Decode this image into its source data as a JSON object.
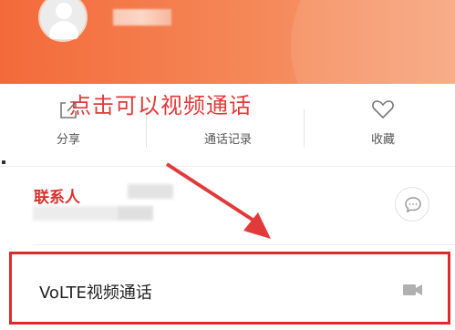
{
  "header": {
    "avatar_icon": "user-avatar-icon",
    "bg_color": "#f36a3a"
  },
  "annotations": {
    "top_text": "点击可以视频通话",
    "contact_tag": "联系人",
    "color": "#e23a3a"
  },
  "actions": [
    {
      "label": "分享",
      "icon": "share-icon"
    },
    {
      "label": "通话记录",
      "icon": "call-log-icon"
    },
    {
      "label": "收藏",
      "icon": "heart-icon"
    }
  ],
  "contact": {
    "message_icon": "message-bubble-icon"
  },
  "volte": {
    "label": "VoLTE视频通话",
    "icon": "video-camera-icon",
    "highlight_color": "#e02a2a"
  }
}
